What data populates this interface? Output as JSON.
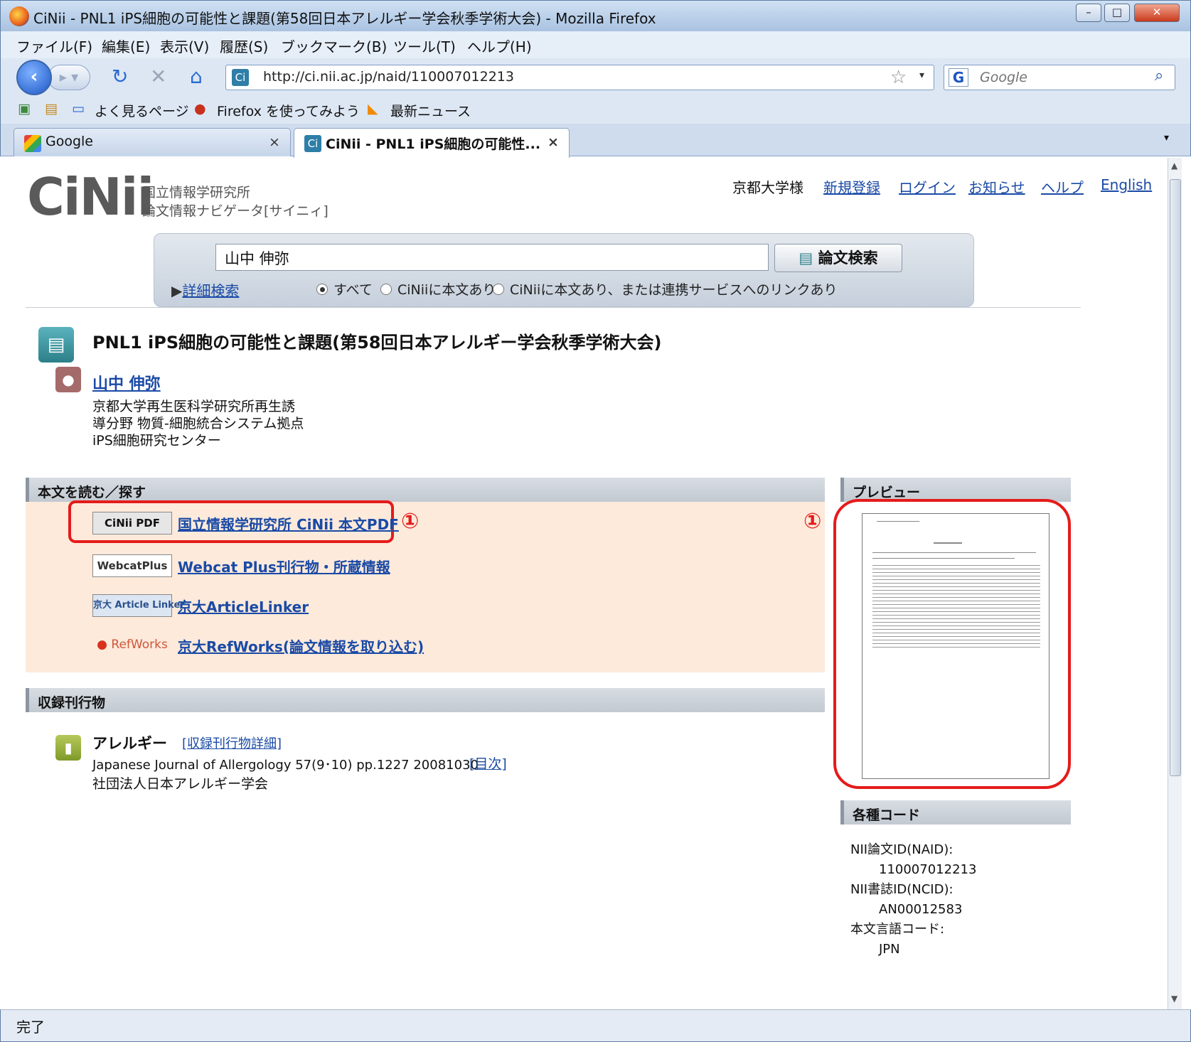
{
  "window": {
    "title": "CiNii - PNL1 iPS細胞の可能性と課題(第58回日本アレルギー学会秋季学術大会) - Mozilla Firefox",
    "controls": {
      "minimize": "–",
      "maximize": "□",
      "close": "✕"
    }
  },
  "menu": [
    "ファイル(F)",
    "編集(E)",
    "表示(V)",
    "履歴(S)",
    "ブックマーク(B)",
    "ツール(T)",
    "ヘルプ(H)"
  ],
  "nav": {
    "url": "http://ci.nii.ac.jp/naid/110007012213",
    "search_placeholder": "Google",
    "search_engine": "G"
  },
  "bookmarks": [
    "よく見るページ",
    "Firefox を使ってみよう",
    "最新ニュース"
  ],
  "tabs": [
    {
      "label": "Google",
      "active": false
    },
    {
      "label": "CiNii - PNL1 iPS細胞の可能性...",
      "active": true
    }
  ],
  "header": {
    "logo": "CiNii",
    "logo_sub1": "国立情報学研究所",
    "logo_sub2": "論文情報ナビゲータ[サイニィ]",
    "user": "京都大学様",
    "links": [
      "新規登録",
      "ログイン",
      "お知らせ",
      "ヘルプ",
      "English"
    ]
  },
  "search": {
    "query": "山中 伸弥",
    "button": "論文検索",
    "advanced": "詳細検索",
    "options": [
      "すべて",
      "CiNiiに本文あり",
      "CiNiiに本文あり、または連携サービスへのリンクあり"
    ],
    "selected": "すべて"
  },
  "article": {
    "title": "PNL1 iPS細胞の可能性と課題(第58回日本アレルギー学会秋季学術大会)",
    "author": "山中 伸弥",
    "affiliation": "京都大学再生医科学研究所再生誘導分野 物質-細胞統合システム拠点iPS細胞研究センター"
  },
  "fulltext": {
    "heading": "本文を読む／探す",
    "links": [
      {
        "badge": "CiNii PDF",
        "label": "国立情報学研究所 CiNii 本文PDF"
      },
      {
        "badge": "WebcatPlus",
        "label": "Webcat Plus刊行物・所蔵情報"
      },
      {
        "badge": "京大 Article Linker",
        "label": "京大ArticleLinker"
      },
      {
        "badge": "RefWorks",
        "label": "京大RefWorks(論文情報を取り込む)"
      }
    ],
    "marker": "①"
  },
  "journal": {
    "heading": "収録刊行物",
    "name": "アレルギー",
    "detail_link": "[収録刊行物詳細]",
    "citation": "Japanese Journal of Allergology 57(9･10) pp.1227 20081030",
    "toc_link": "[目次]",
    "publisher": "社団法人日本アレルギー学会"
  },
  "preview": {
    "heading": "プレビュー",
    "marker": "①"
  },
  "codes": {
    "heading": "各種コード",
    "naid_label": "NII論文ID(NAID):",
    "naid": "110007012213",
    "ncid_label": "NII書誌ID(NCID):",
    "ncid": "AN00012583",
    "lang_label": "本文言語コード:",
    "lang": "JPN"
  },
  "status": "完了"
}
